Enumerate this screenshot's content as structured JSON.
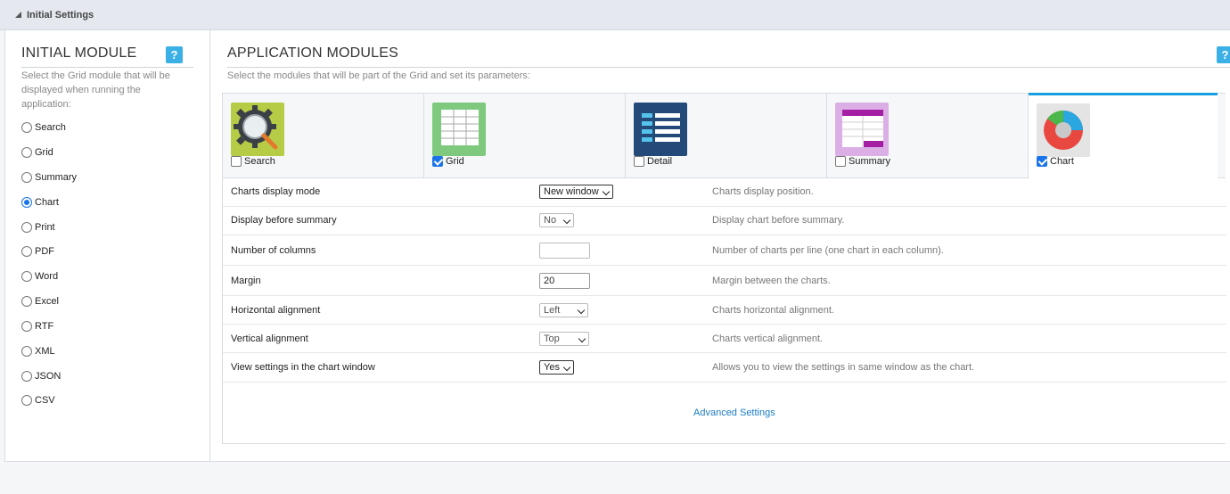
{
  "header": {
    "title": "Initial Settings"
  },
  "initial_module": {
    "title": "INITIAL MODULE",
    "help": "?",
    "description": "Select the Grid module that will be displayed when running the application:",
    "options": [
      "Search",
      "Grid",
      "Summary",
      "Chart",
      "Print",
      "PDF",
      "Word",
      "Excel",
      "RTF",
      "XML",
      "JSON",
      "CSV"
    ],
    "selected": "Chart"
  },
  "app_modules": {
    "title": "APPLICATION MODULES",
    "help": "?",
    "description": "Select the modules that will be part of the Grid and set its parameters:",
    "modules": [
      {
        "label": "Search",
        "checked": false,
        "icon": "search-gear-icon"
      },
      {
        "label": "Grid",
        "checked": true,
        "icon": "grid-table-icon"
      },
      {
        "label": "Detail",
        "checked": false,
        "icon": "detail-list-icon"
      },
      {
        "label": "Summary",
        "checked": false,
        "icon": "summary-table-icon"
      },
      {
        "label": "Chart",
        "checked": true,
        "icon": "pie-chart-icon"
      }
    ]
  },
  "settings": [
    {
      "label": "Charts display mode",
      "control": "select",
      "value": "New window",
      "hint": "Charts display position."
    },
    {
      "label": "Display before summary",
      "control": "select",
      "value": "No",
      "hint": "Display chart before summary."
    },
    {
      "label": "Number of columns",
      "control": "input",
      "value": "",
      "hint": "Number of charts per line (one chart in each column)."
    },
    {
      "label": "Margin",
      "control": "input",
      "value": "20",
      "hint": "Margin between the charts."
    },
    {
      "label": "Horizontal alignment",
      "control": "select",
      "value": "Left",
      "hint": "Charts horizontal alignment."
    },
    {
      "label": "Vertical alignment",
      "control": "select",
      "value": "Top",
      "hint": "Charts vertical alignment."
    },
    {
      "label": "View settings in the chart window",
      "control": "select",
      "value": "Yes",
      "hint": "Allows you to view the settings in same window as the chart."
    }
  ],
  "advanced_link": "Advanced Settings",
  "colors": {
    "accent": "#1a9ee2",
    "help_button": "#3ab0e6",
    "link": "#1a7bc4"
  }
}
